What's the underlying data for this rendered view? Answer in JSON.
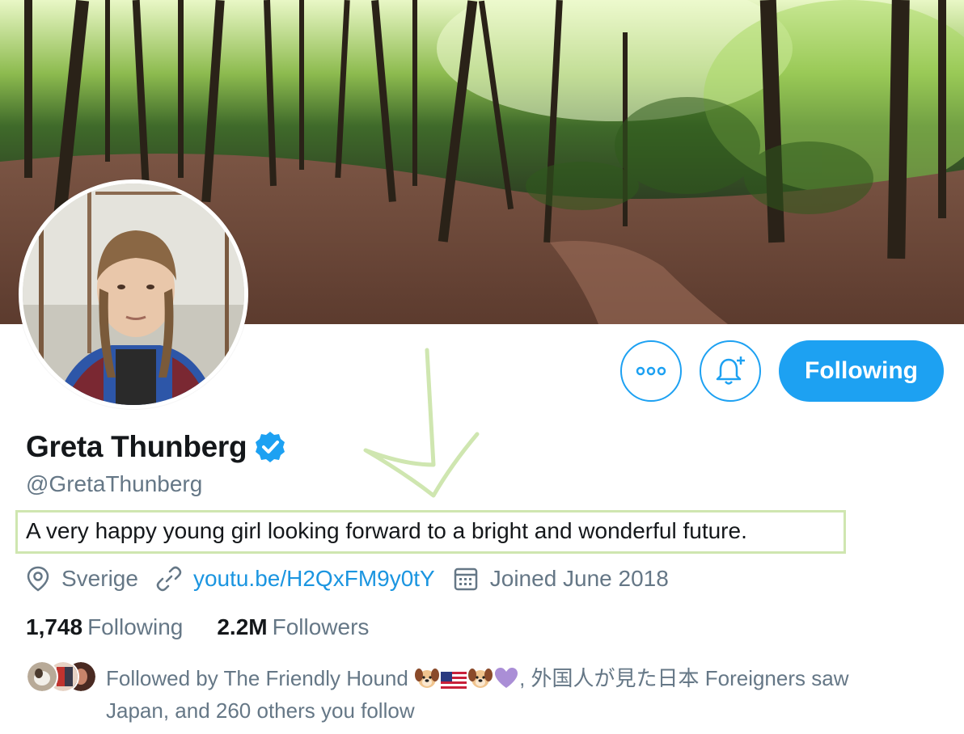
{
  "profile": {
    "name": "Greta Thunberg",
    "handle": "@GretaThunberg",
    "bio": "A very happy young girl looking forward to a bright and wonderful future.",
    "location": "Sverige",
    "website": "youtu.be/H2QxFM9y0tY",
    "joined": "Joined June 2018"
  },
  "actions": {
    "following_label": "Following"
  },
  "stats": {
    "following_count": "1,748",
    "following_label": "Following",
    "followers_count": "2.2M",
    "followers_label": "Followers"
  },
  "followed_by": {
    "prefix": "Followed by The Friendly Hound",
    "suffix": ", 外国人が見た日本 Foreigners saw Japan, and 260 others you follow"
  },
  "colors": {
    "accent": "#1da1f2",
    "link": "#1b95e0",
    "secondary_text": "#657786",
    "annotation": "#cfe6b0"
  },
  "icons": [
    "more-icon",
    "bell-plus-icon",
    "verified-badge-icon",
    "location-pin-icon",
    "link-icon",
    "calendar-icon",
    "dog-emoji-icon",
    "us-flag-emoji-icon",
    "purple-heart-emoji-icon"
  ]
}
